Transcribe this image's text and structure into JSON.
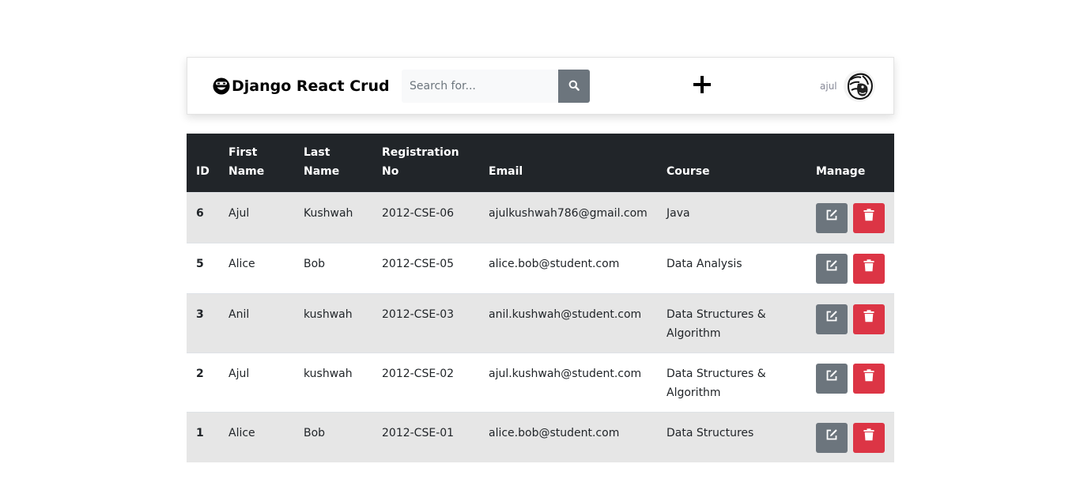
{
  "navbar": {
    "brand": "Django React Crud",
    "search_placeholder": "Search for...",
    "username": "ajul"
  },
  "table": {
    "headers": {
      "id": "ID",
      "first_name": "First Name",
      "last_name": "Last Name",
      "registration_no": "Registration No",
      "email": "Email",
      "course": "Course",
      "manage": "Manage"
    },
    "rows": [
      {
        "id": "6",
        "first_name": "Ajul",
        "last_name": "Kushwah",
        "registration_no": "2012-CSE-06",
        "email": "ajulkushwah786@gmail.com",
        "course": "Java"
      },
      {
        "id": "5",
        "first_name": "Alice",
        "last_name": "Bob",
        "registration_no": "2012-CSE-05",
        "email": "alice.bob@student.com",
        "course": "Data Analysis"
      },
      {
        "id": "3",
        "first_name": "Anil",
        "last_name": "kushwah",
        "registration_no": "2012-CSE-03",
        "email": "anil.kushwah@student.com",
        "course": "Data Structures & Algorithm"
      },
      {
        "id": "2",
        "first_name": "Ajul",
        "last_name": "kushwah",
        "registration_no": "2012-CSE-02",
        "email": "ajul.kushwah@student.com",
        "course": "Data Structures & Algorithm"
      },
      {
        "id": "1",
        "first_name": "Alice",
        "last_name": "Bob",
        "registration_no": "2012-CSE-01",
        "email": "alice.bob@student.com",
        "course": "Data Structures"
      }
    ]
  },
  "icons": {
    "brand": "smiley-icon",
    "search": "search-icon",
    "add": "plus-icon",
    "edit": "edit-icon",
    "delete": "trash-icon"
  },
  "colors": {
    "header_bg": "#212529",
    "search_btn": "#6c757d",
    "edit_btn": "#6c757d",
    "delete_btn": "#dc3545",
    "striped_row": "#e6e6e6"
  }
}
